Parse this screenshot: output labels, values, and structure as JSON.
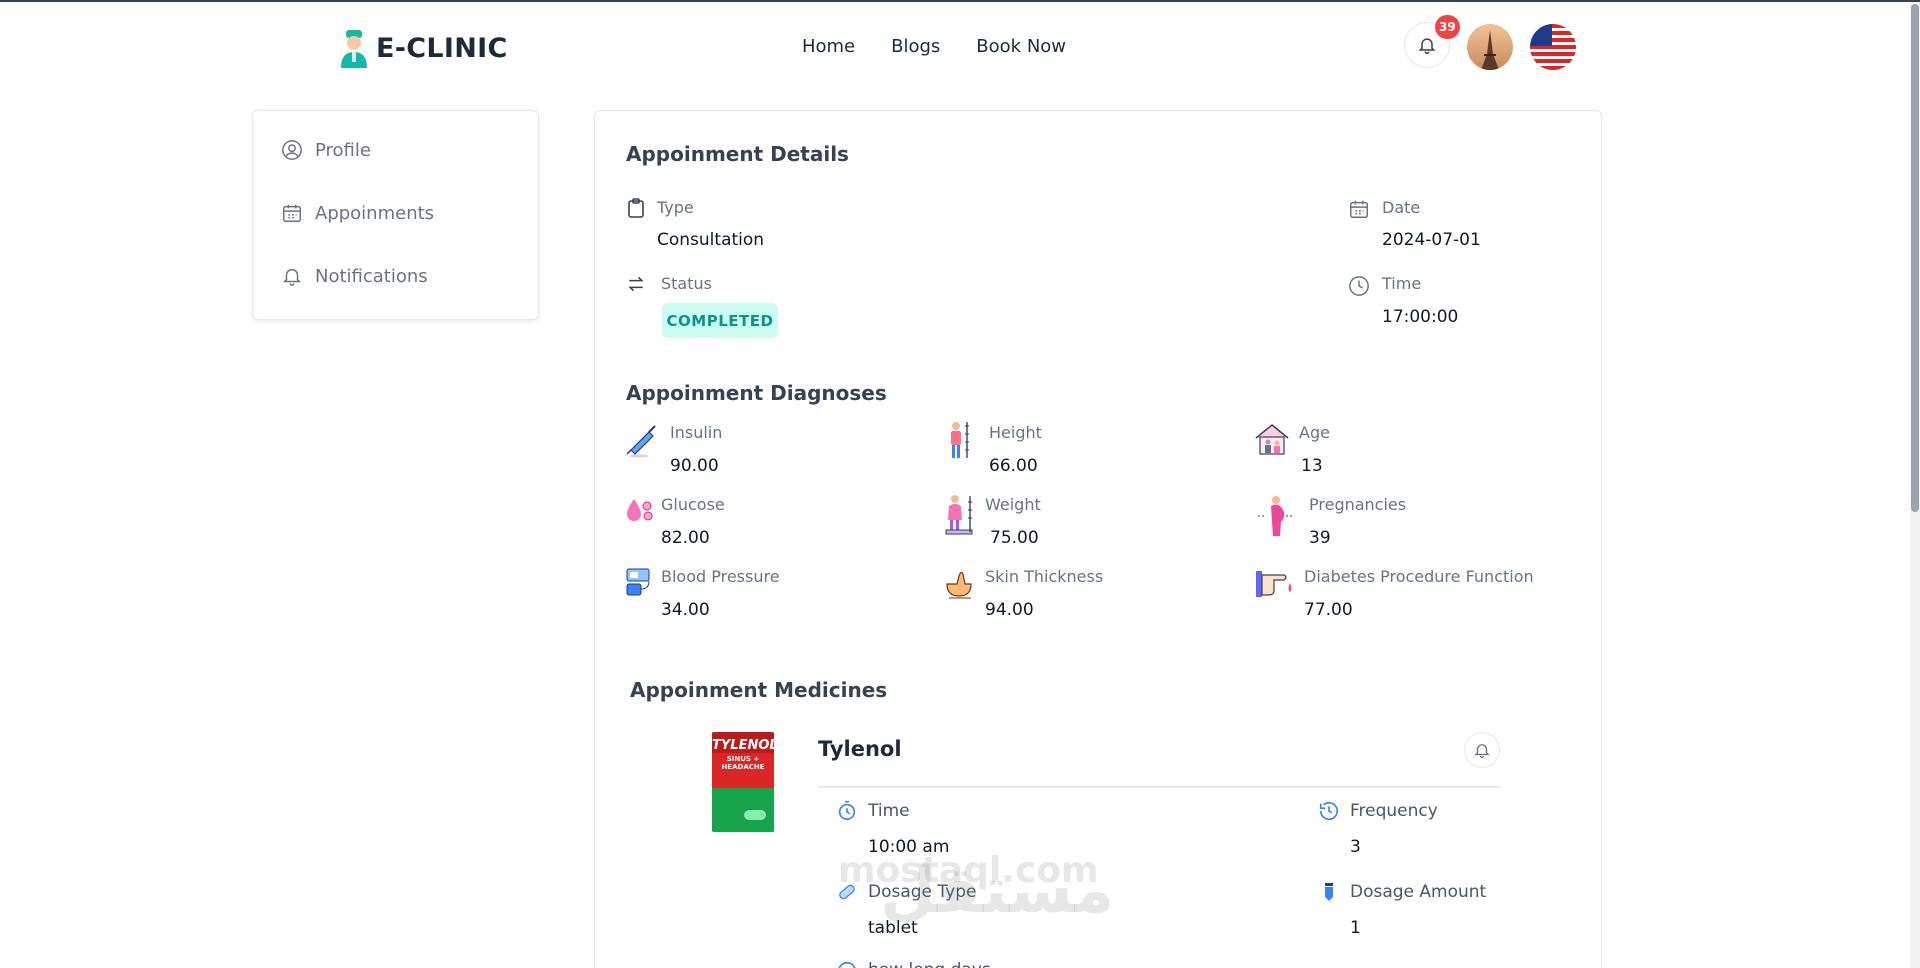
{
  "header": {
    "logo_text": "E-CLINIC",
    "nav": [
      "Home",
      "Blogs",
      "Book Now"
    ],
    "notification_count": "39"
  },
  "sidebar": {
    "items": [
      {
        "label": "Profile",
        "icon": "user-circle-icon"
      },
      {
        "label": "Appoinments",
        "icon": "calendar-icon"
      },
      {
        "label": "Notifications",
        "icon": "bell-icon"
      }
    ]
  },
  "details": {
    "title": "Appoinment Details",
    "type_label": "Type",
    "type_value": "Consultation",
    "status_label": "Status",
    "status_value": "COMPLETED",
    "date_label": "Date",
    "date_value": "2024-07-01",
    "time_label": "Time",
    "time_value": "17:00:00"
  },
  "diagnoses": {
    "title": "Appoinment Diagnoses",
    "items": [
      {
        "label": "Insulin",
        "value": "90.00"
      },
      {
        "label": "Height",
        "value": "66.00"
      },
      {
        "label": "Age",
        "value": "13"
      },
      {
        "label": "Glucose",
        "value": "82.00"
      },
      {
        "label": "Weight",
        "value": "75.00"
      },
      {
        "label": "Pregnancies",
        "value": "39"
      },
      {
        "label": "Blood Pressure",
        "value": "34.00"
      },
      {
        "label": "Skin Thickness",
        "value": "94.00"
      },
      {
        "label": "Diabetes Procedure Function",
        "value": "77.00"
      }
    ]
  },
  "medicines": {
    "title": "Appoinment Medicines",
    "name": "Tylenol",
    "box_brand": "TYLENOL",
    "box_sub": "SINUS + HEADACHE",
    "time_label": "Time",
    "time_value": "10:00 am",
    "frequency_label": "Frequency",
    "frequency_value": "3",
    "dosage_type_label": "Dosage Type",
    "dosage_type_value": "tablet",
    "dosage_amount_label": "Dosage Amount",
    "dosage_amount_value": "1",
    "days_label": "how long days"
  },
  "watermark": "mostaql.com",
  "watermark_ar": "مستقل",
  "colors": {
    "status_bg": "#ccfbf1",
    "status_text": "#0d9488",
    "badge": "#ef4444"
  }
}
